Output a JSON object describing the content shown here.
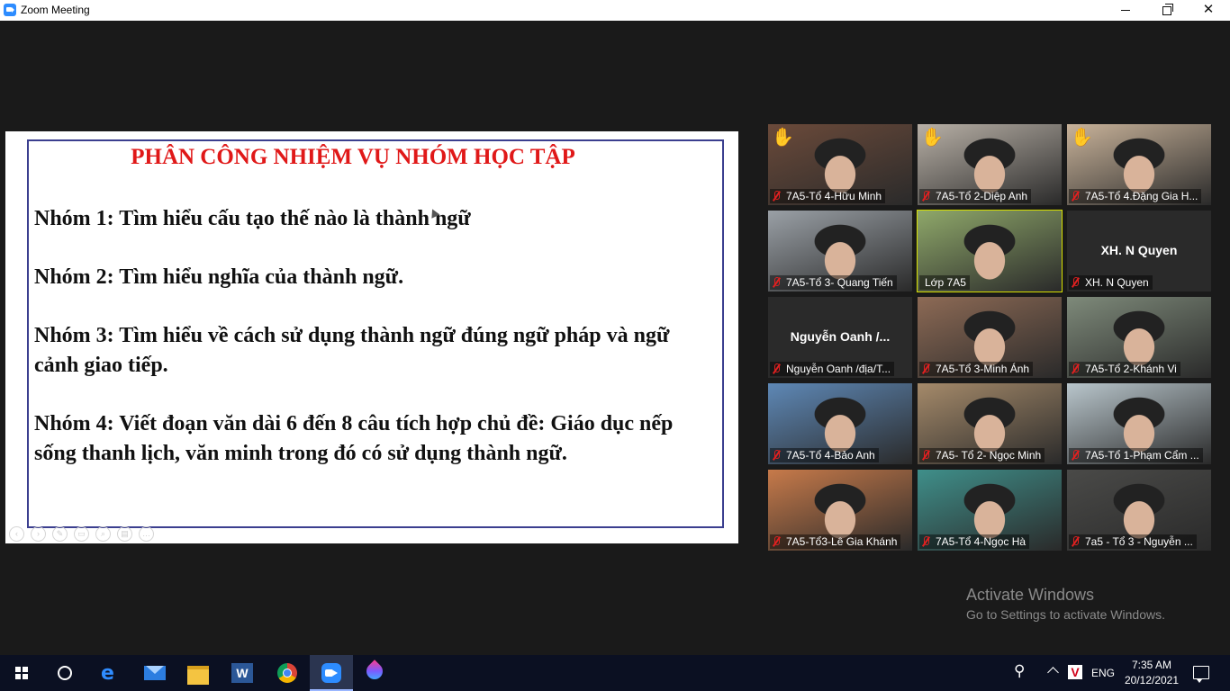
{
  "window": {
    "title": "Zoom Meeting"
  },
  "slide": {
    "title": "PHÂN CÔNG NHIỆM VỤ NHÓM HỌC TẬP",
    "lines": [
      "Nhóm 1: Tìm hiểu cấu tạo thế nào là thành ngữ",
      "Nhóm 2: Tìm hiểu nghĩa  của thành ngữ.",
      "Nhóm 3: Tìm hiểu về cách sử dụng thành ngữ đúng ngữ pháp và ngữ cảnh giao tiếp.",
      "Nhóm 4: Viết đoạn văn dài 6 đến 8 câu tích hợp chủ đề: Giáo dục nếp sống thanh lịch, văn minh trong đó có sử dụng thành ngữ."
    ]
  },
  "participants": [
    {
      "name": "7A5-Tổ 4-Hữu Minh",
      "muted": true,
      "hand_raised": true,
      "video": true,
      "tone": "#6b4a3a"
    },
    {
      "name": "7A5-Tổ 2-Diệp Anh",
      "muted": true,
      "hand_raised": true,
      "video": true,
      "tone": "#b8b0a6"
    },
    {
      "name": "7A5-Tổ 4.Đặng Gia H...",
      "muted": true,
      "hand_raised": true,
      "video": true,
      "tone": "#c9b39a"
    },
    {
      "name": "7A5-Tổ 3- Quang Tiến",
      "muted": true,
      "hand_raised": false,
      "video": true,
      "tone": "#9aa0a6"
    },
    {
      "name": "Lớp 7A5",
      "muted": false,
      "hand_raised": false,
      "video": true,
      "active": true,
      "tone": "#8fa86a"
    },
    {
      "name": "XH. N Quyen",
      "muted": true,
      "hand_raised": false,
      "video": false,
      "display_name": "XH. N Quyen"
    },
    {
      "name": "Nguyễn Oanh /địa/T...",
      "muted": true,
      "hand_raised": false,
      "video": false,
      "display_name": "Nguyễn Oanh /..."
    },
    {
      "name": "7A5-Tổ 3-Minh Ánh",
      "muted": true,
      "hand_raised": false,
      "video": true,
      "tone": "#8d6a55"
    },
    {
      "name": "7A5-Tổ 2-Khánh Vi",
      "muted": true,
      "hand_raised": false,
      "video": true,
      "tone": "#7e8a7a"
    },
    {
      "name": "7A5-Tổ 4-Bảo Anh",
      "muted": true,
      "hand_raised": false,
      "video": true,
      "tone": "#5e88b6"
    },
    {
      "name": "7A5- Tổ 2- Ngọc Minh",
      "muted": true,
      "hand_raised": false,
      "video": true,
      "tone": "#a58a6a"
    },
    {
      "name": "7A5-Tổ 1-Phạm Cẩm ...",
      "muted": true,
      "hand_raised": false,
      "video": true,
      "tone": "#b9c6cc"
    },
    {
      "name": "7A5-Tổ3-Lê Gia Khánh",
      "muted": true,
      "hand_raised": false,
      "video": true,
      "tone": "#c77a4a"
    },
    {
      "name": "7A5-Tổ 4-Ngọc Hà",
      "muted": true,
      "hand_raised": false,
      "video": true,
      "tone": "#3f8f8a"
    },
    {
      "name": "7a5 - Tổ 3 - Nguyễn ...",
      "muted": true,
      "hand_raised": false,
      "video": true,
      "tone": "#4a4a48"
    }
  ],
  "watermark": {
    "title": "Activate Windows",
    "subtitle": "Go to Settings to activate Windows."
  },
  "taskbar": {
    "apps": [
      "start-icon",
      "search-icon",
      "edge-icon",
      "mail-icon",
      "file-explorer-icon",
      "word-icon",
      "chrome-icon",
      "zoom-icon",
      "paint-drop-icon"
    ],
    "language": "ENG",
    "time": "7:35 AM",
    "date": "20/12/2021"
  }
}
